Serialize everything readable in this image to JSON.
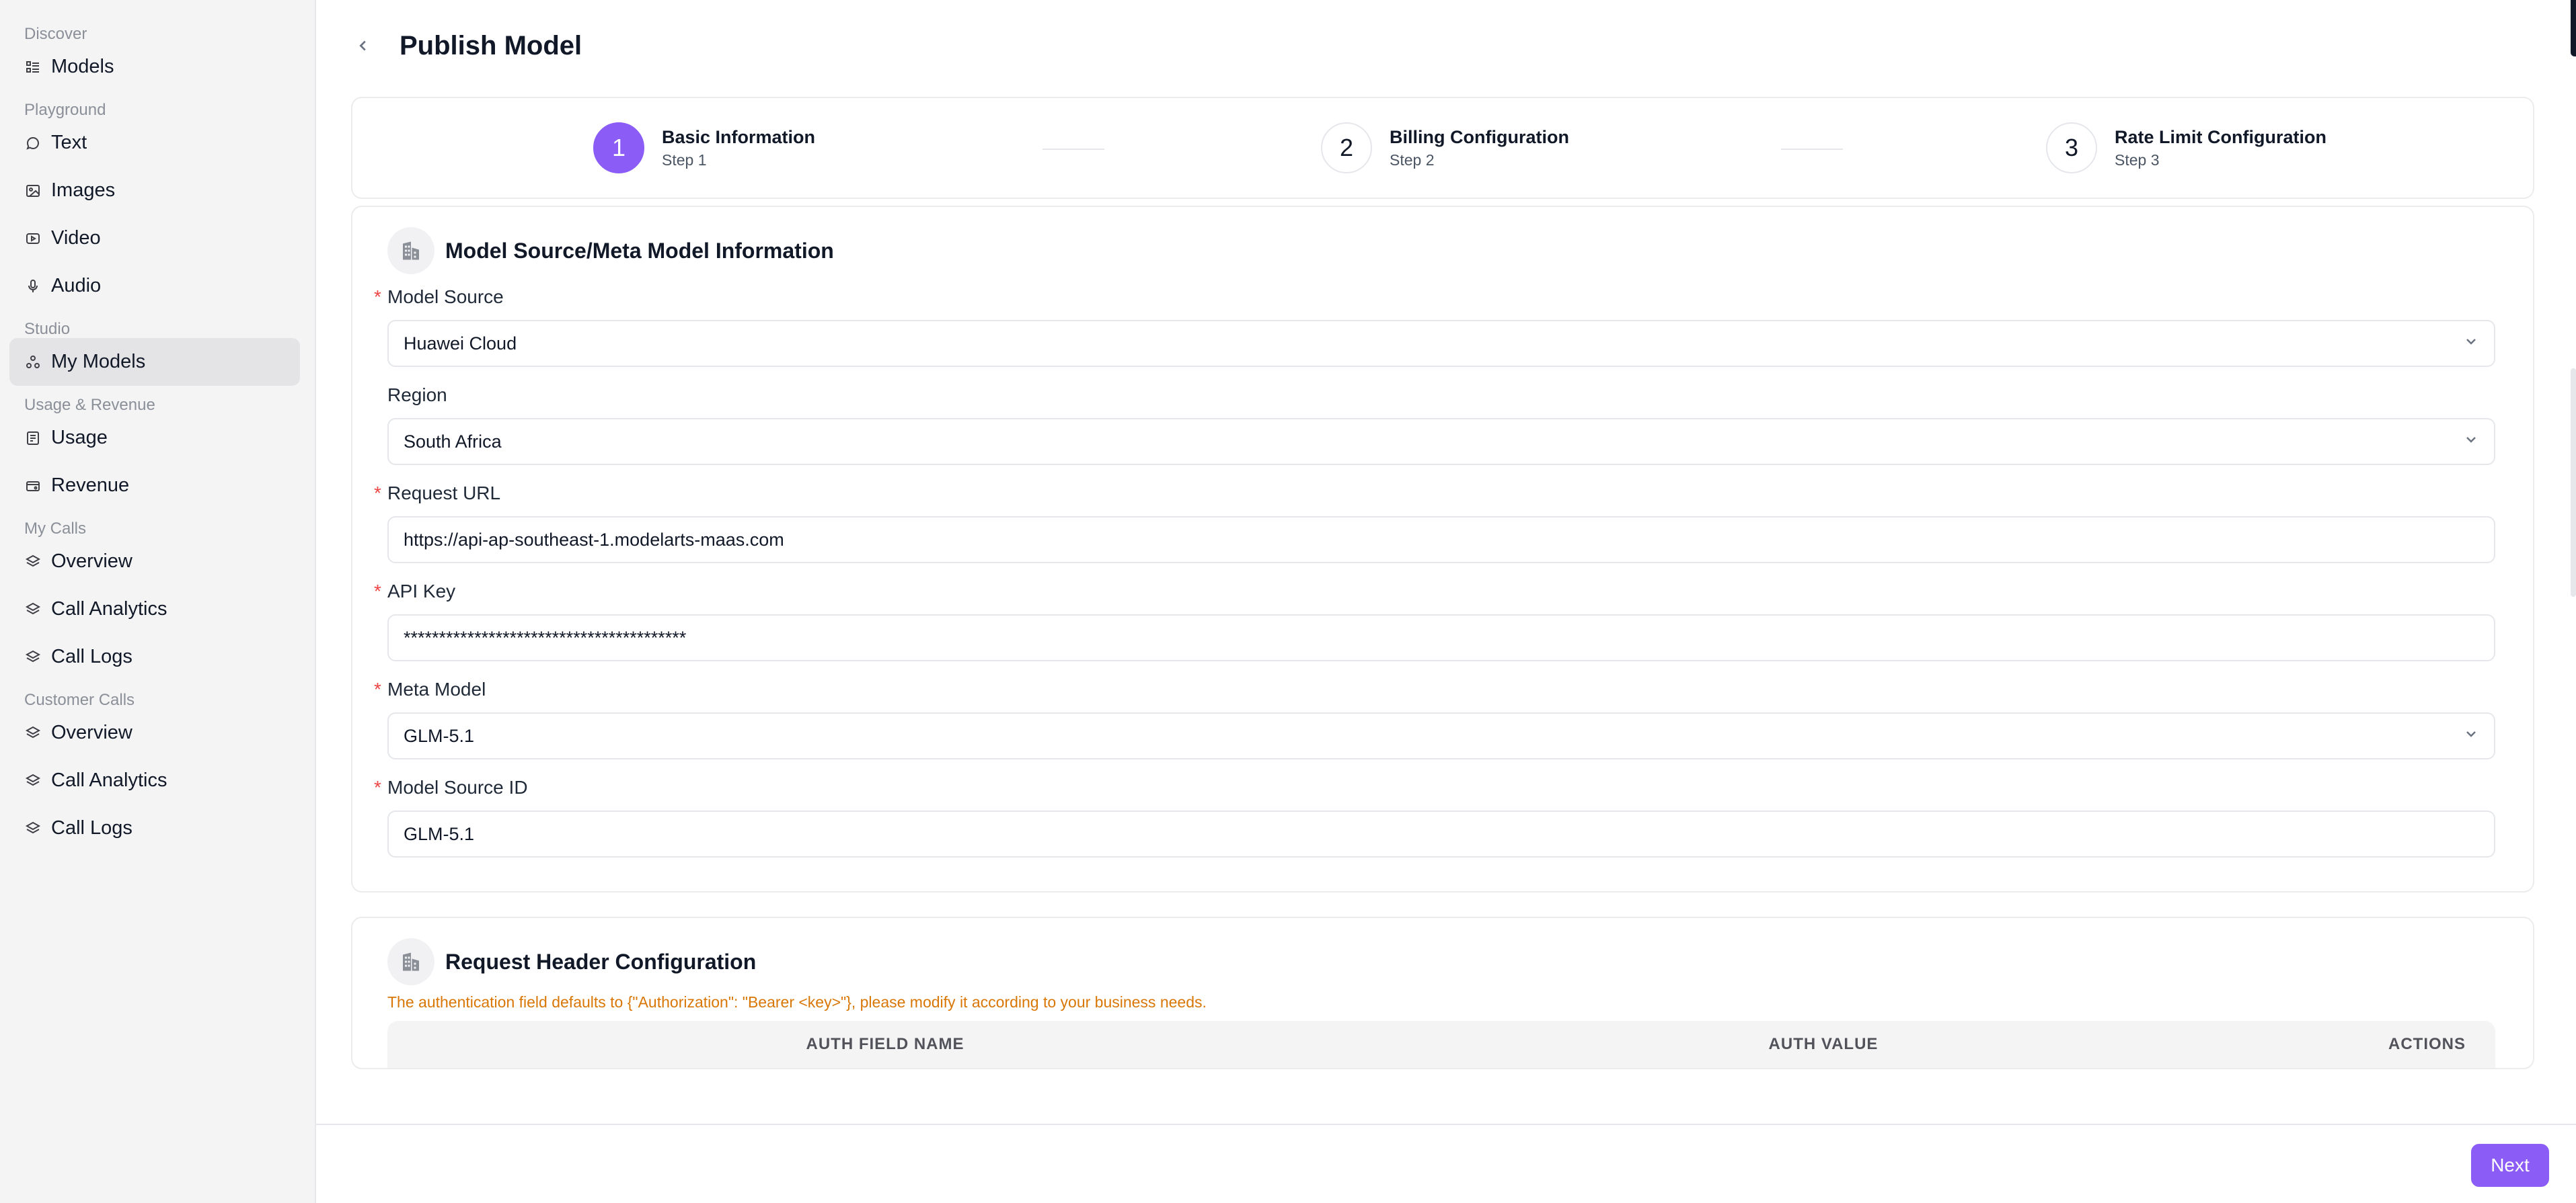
{
  "sidebar": {
    "groups": [
      {
        "label": "Discover",
        "items": [
          {
            "label": "Models",
            "icon": "models-icon"
          }
        ]
      },
      {
        "label": "Playground",
        "items": [
          {
            "label": "Text",
            "icon": "chat-icon"
          },
          {
            "label": "Images",
            "icon": "image-icon"
          },
          {
            "label": "Video",
            "icon": "video-icon"
          },
          {
            "label": "Audio",
            "icon": "mic-icon"
          }
        ]
      },
      {
        "label": "Studio",
        "items": [
          {
            "label": "My Models",
            "icon": "nodes-icon",
            "active": true
          }
        ]
      },
      {
        "label": "Usage & Revenue",
        "items": [
          {
            "label": "Usage",
            "icon": "usage-icon"
          },
          {
            "label": "Revenue",
            "icon": "revenue-icon"
          }
        ]
      },
      {
        "label": "My Calls",
        "items": [
          {
            "label": "Overview",
            "icon": "layers-icon"
          },
          {
            "label": "Call Analytics",
            "icon": "layers-icon"
          },
          {
            "label": "Call Logs",
            "icon": "layers-icon"
          }
        ]
      },
      {
        "label": "Customer Calls",
        "items": [
          {
            "label": "Overview",
            "icon": "layers-icon"
          },
          {
            "label": "Call Analytics",
            "icon": "layers-icon"
          },
          {
            "label": "Call Logs",
            "icon": "layers-icon"
          }
        ]
      }
    ]
  },
  "header": {
    "title": "Publish Model"
  },
  "steps": [
    {
      "number": "1",
      "title": "Basic Information",
      "sub": "Step 1",
      "active": true
    },
    {
      "number": "2",
      "title": "Billing Configuration",
      "sub": "Step 2"
    },
    {
      "number": "3",
      "title": "Rate Limit Configuration",
      "sub": "Step 3"
    }
  ],
  "source_section": {
    "title": "Model Source/Meta Model Information",
    "fields": {
      "model_source": {
        "label": "Model Source",
        "value": "Huawei Cloud"
      },
      "region": {
        "label": "Region",
        "value": "South Africa"
      },
      "request_url": {
        "label": "Request URL",
        "value": "https://api-ap-southeast-1.modelarts-maas.com"
      },
      "api_key": {
        "label": "API Key",
        "value": "****************************************"
      },
      "meta_model": {
        "label": "Meta Model",
        "value": "GLM-5.1"
      },
      "model_source_id": {
        "label": "Model Source ID",
        "value": "GLM-5.1"
      }
    }
  },
  "header_section": {
    "title": "Request Header Configuration",
    "notice": "The authentication field defaults to {\"Authorization\": \"Bearer <key>\"}, please modify it according to your business needs.",
    "columns": [
      "AUTH FIELD NAME",
      "AUTH VALUE",
      "ACTIONS"
    ]
  },
  "footer": {
    "next_label": "Next"
  },
  "colors": {
    "accent": "#8b5cf6",
    "warning": "#d97706",
    "required": "#ef4444"
  }
}
